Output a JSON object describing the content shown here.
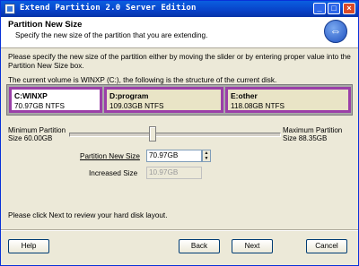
{
  "window": {
    "title": "Extend Partition 2.0 Server Edition"
  },
  "header": {
    "title": "Partition New Size",
    "subtitle": "Specify the new size of the partition that you are extending."
  },
  "instructions": "Please specify the new size of the partition either by moving the slider or by entering proper value into the Partition New Size box.",
  "volume_text": "The current volume is WINXP (C:), the following is the structure of the current disk.",
  "partitions": [
    {
      "name": "C:WINXP",
      "info": "70.97GB NTFS"
    },
    {
      "name": "D:program",
      "info": "109.03GB NTFS"
    },
    {
      "name": "E:other",
      "info": "118.08GB NTFS"
    }
  ],
  "slider": {
    "min_label_1": "Minimum Partition",
    "min_label_2": "Size 60.00GB",
    "max_label_1": "Maximum Partition",
    "max_label_2": "Size 88.35GB",
    "position_fraction": 0.39
  },
  "fields": {
    "new_size_label": "Partition New Size",
    "new_size_value": "70.97GB",
    "increased_label": "Increased Size",
    "increased_value": "10.97GB"
  },
  "footer_text": "Please click Next to review your hard disk layout.",
  "buttons": {
    "help": "Help",
    "back": "Back",
    "next": "Next",
    "cancel": "Cancel"
  },
  "icons": {
    "app": "app-icon",
    "header": "arrows-icon"
  }
}
